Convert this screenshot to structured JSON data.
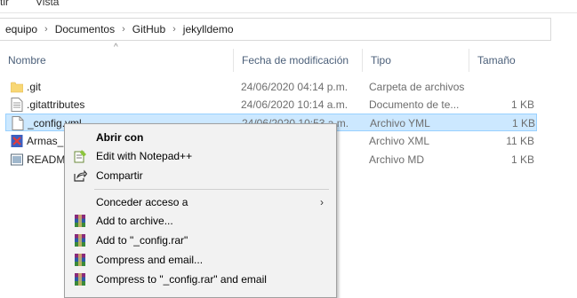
{
  "ribbon": {
    "item1": "tir",
    "item2": "Vista"
  },
  "address": {
    "crumbs": [
      "equipo",
      "Documentos",
      "GitHub",
      "jekylldemo"
    ]
  },
  "columns": {
    "name": "Nombre",
    "date": "Fecha de modificación",
    "type": "Tipo",
    "size": "Tamaño"
  },
  "files": [
    {
      "name": ".git",
      "date": "24/06/2020 04:14 p.m.",
      "type": "Carpeta de archivos",
      "size": "",
      "icon": "folder-icon"
    },
    {
      "name": ".gitattributes",
      "date": "24/06/2020 10:14 a.m.",
      "type": "Documento de te...",
      "size": "1 KB",
      "icon": "text-file-icon"
    },
    {
      "name": "_config.yml",
      "date": "24/06/2020 10:53 a.m.",
      "type": "Archivo YML",
      "size": "1 KB",
      "icon": "file-icon"
    },
    {
      "name": "Armas_l",
      "date": "",
      "type": "Archivo XML",
      "size": "11 KB",
      "icon": "xml-file-icon"
    },
    {
      "name": "README",
      "date": "",
      "type": "Archivo MD",
      "size": "1 KB",
      "icon": "md-file-icon"
    }
  ],
  "context_menu": {
    "open_with": "Abrir con",
    "edit_notepad": "Edit with Notepad++",
    "share": "Compartir",
    "grant_access": "Conceder acceso a",
    "add_archive": "Add to archive...",
    "add_rar": "Add to \"_config.rar\"",
    "compress_email": "Compress and email...",
    "compress_rar_email": "Compress to \"_config.rar\" and email"
  },
  "colors": {
    "selection": "#cce8ff",
    "selection_border": "#99d1ff",
    "header_text": "#4c607a",
    "menu_bg": "#f2f2f2"
  }
}
